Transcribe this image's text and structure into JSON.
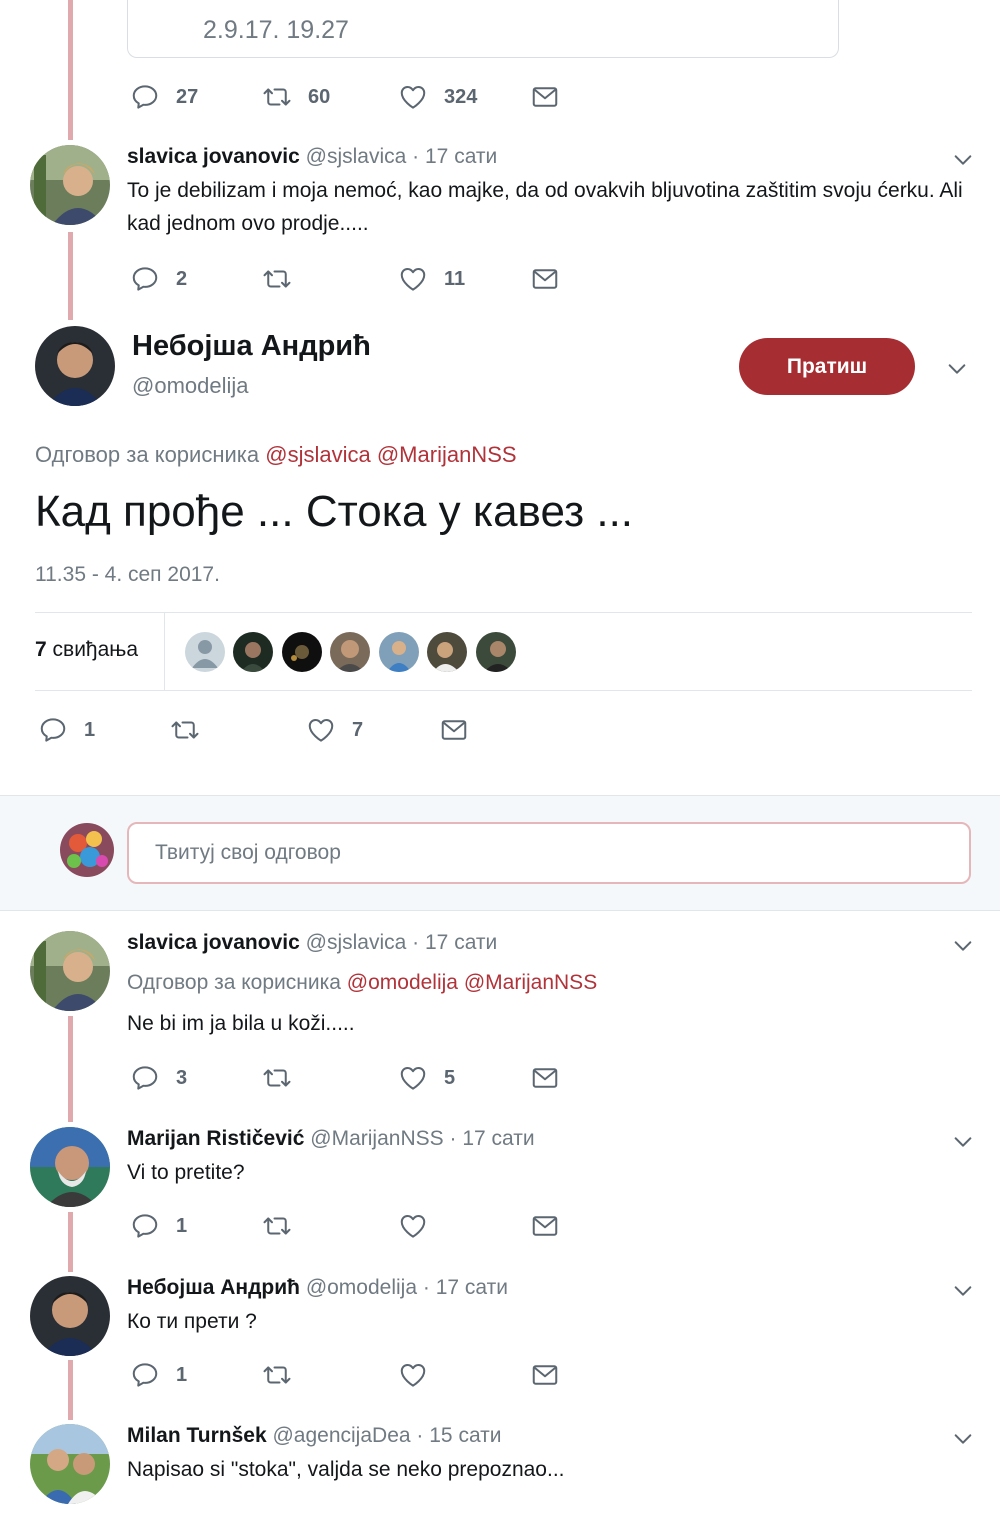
{
  "quoted": {
    "time": "2.9.17. 19.27"
  },
  "top_actions": {
    "reply": "27",
    "retweet": "60",
    "like": "324"
  },
  "tweet1": {
    "name": "slavica jovanovic",
    "handle": "@sjslavica",
    "sep": "·",
    "time": "17 сати",
    "text": "To je debilizam i moja nemoć, kao majke, da od ovakvih bljuvotina zaštitim svoju ćerku. Ali kad jednom ovo prodje.....",
    "actions": {
      "reply": "2",
      "retweet": "",
      "like": "11"
    }
  },
  "main": {
    "name": "Небојша Андрић",
    "handle": "@omodelija",
    "follow_label": "Пратиш",
    "reply_prefix": "Одговор за корисника",
    "reply_mention1": "@sjslavica",
    "reply_mention2": "@MarijanNSS",
    "text": "Кад прође ... Стока у кавез ...",
    "date": "11.35 - 4. сеп 2017.",
    "likes_count": "7",
    "likes_label": "свиђања",
    "actions": {
      "reply": "1",
      "retweet": "",
      "like": "7"
    }
  },
  "composer": {
    "placeholder": "Твитуј свој одговор"
  },
  "replies": [
    {
      "name": "slavica jovanovic",
      "handle": "@sjslavica",
      "sep": "·",
      "time": "17 сати",
      "reply_prefix": "Одговор за корисника",
      "mention1": "@omodelija",
      "mention2": "@MarijanNSS",
      "text": "Ne bi im ja bila u koži.....",
      "actions": {
        "reply": "3",
        "retweet": "",
        "like": "5"
      }
    },
    {
      "name": "Marijan Rističević",
      "handle": "@MarijanNSS",
      "sep": "·",
      "time": "17 сати",
      "text": "Vi to pretite?",
      "actions": {
        "reply": "1",
        "retweet": "",
        "like": ""
      }
    },
    {
      "name": "Небојша Андрић",
      "handle": "@omodelija",
      "sep": "·",
      "time": "17 сати",
      "text": "Ко ти прети ?",
      "actions": {
        "reply": "1",
        "retweet": "",
        "like": ""
      }
    },
    {
      "name": "Milan Turnšek",
      "handle": "@agencijaDea",
      "sep": "·",
      "time": "15 сати",
      "text": "Napisao si \"stoka\", valjda se neko prepoznao..."
    }
  ],
  "colors": {
    "accent": "#b1333a",
    "follow_button": "#a62d31",
    "thread_line": "#e0a9ad",
    "muted": "#707a82"
  }
}
